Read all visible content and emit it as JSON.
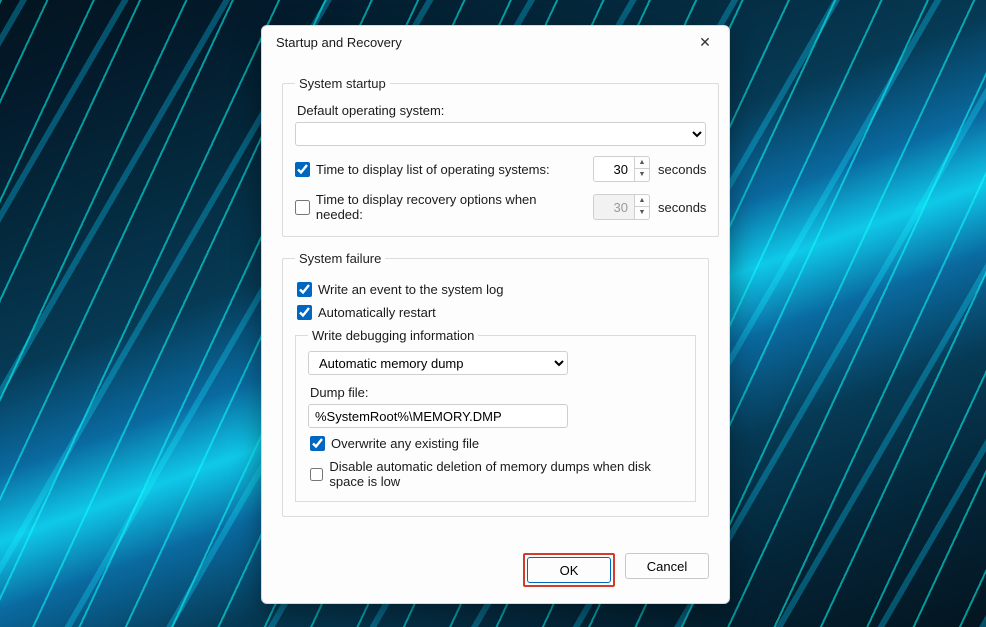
{
  "dialog": {
    "title": "Startup and Recovery",
    "system_startup": {
      "legend": "System startup",
      "default_os_label": "Default operating system:",
      "default_os_value": "",
      "time_os_list": {
        "label": "Time to display list of operating systems:",
        "checked": true,
        "value": "30",
        "unit": "seconds"
      },
      "time_recovery": {
        "label": "Time to display recovery options when needed:",
        "checked": false,
        "value": "30",
        "unit": "seconds"
      }
    },
    "system_failure": {
      "legend": "System failure",
      "write_event": {
        "label": "Write an event to the system log",
        "checked": true
      },
      "auto_restart": {
        "label": "Automatically restart",
        "checked": true
      },
      "debug_group": {
        "legend": "Write debugging information",
        "dump_type": "Automatic memory dump",
        "dump_file_label": "Dump file:",
        "dump_file_value": "%SystemRoot%\\MEMORY.DMP",
        "overwrite": {
          "label": "Overwrite any existing file",
          "checked": true
        },
        "disable_delete": {
          "label": "Disable automatic deletion of memory dumps when disk space is low",
          "checked": false
        }
      }
    },
    "buttons": {
      "ok": "OK",
      "cancel": "Cancel"
    }
  }
}
